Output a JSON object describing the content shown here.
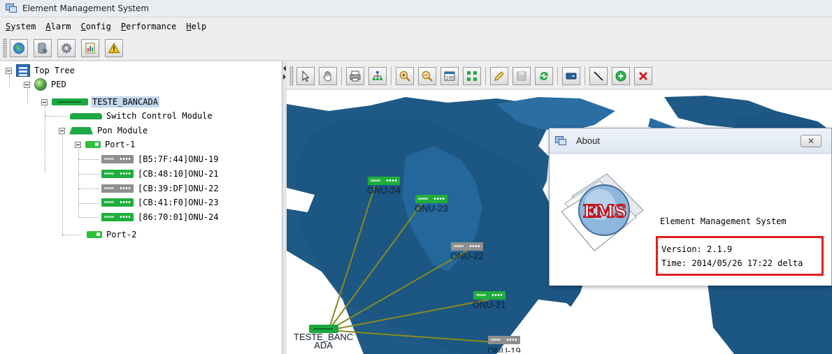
{
  "window": {
    "title": "Element Management System"
  },
  "menu": [
    {
      "label": "System",
      "mnemonic": "S",
      "rest": "ystem"
    },
    {
      "label": "Alarm",
      "mnemonic": "A",
      "rest": "larm"
    },
    {
      "label": "Config",
      "mnemonic": "C",
      "rest": "onfig"
    },
    {
      "label": "Performance",
      "mnemonic": "P",
      "rest": "erformance"
    },
    {
      "label": "Help",
      "mnemonic": "H",
      "rest": "elp"
    }
  ],
  "toolbar_icons": [
    "network-globe-icon",
    "database-icon",
    "settings-gear-icon",
    "report-icon",
    "alarm-warning-icon"
  ],
  "map_toolbar_icons": [
    "select-pointer-icon",
    "pan-hand-icon",
    "print-icon",
    "topology-icon",
    "zoom-in-icon",
    "zoom-out-icon",
    "zoom-100-icon",
    "fit-view-icon",
    "edit-icon",
    "save-icon",
    "refresh-icon",
    "add-device-icon",
    "draw-link-icon",
    "add-icon",
    "delete-icon"
  ],
  "tree": {
    "root": "Top Tree",
    "group": "PED",
    "olt": "TESTE_BANCADA",
    "switch_module": "Switch Control Module",
    "pon_module": "Pon Module",
    "port1": "Port-1",
    "onus": [
      {
        "label": "[B5:7F:44]ONU-19",
        "status": "offline"
      },
      {
        "label": "[CB:48:10]ONU-21",
        "status": "online"
      },
      {
        "label": "[CB:39:DF]ONU-22",
        "status": "offline"
      },
      {
        "label": "[CB:41:F0]ONU-23",
        "status": "online"
      },
      {
        "label": "[86:70:01]ONU-24",
        "status": "online"
      }
    ],
    "port2": "Port-2"
  },
  "map": {
    "olt_label_line1": "TESTE_BANC",
    "olt_label_line2": "ADA",
    "onu24": "ONU-24",
    "onu23": "ONU-23",
    "onu22": "ONU-22",
    "onu21": "ONU-21",
    "onu19": "ONU-19",
    "colors": {
      "ocean": "#ffffff",
      "land": "#1f5a86",
      "link": "#8a8a1e",
      "online": "#1fae3c",
      "offline": "#8f8f8f"
    }
  },
  "about": {
    "title": "About",
    "close_glyph": "✕",
    "logo_text": "EMS",
    "app_name": "Element Management System",
    "version_line": "Version: 2.1.9",
    "time_line": "Time: 2014/05/26 17:22 delta",
    "highlight_color": "#e0201f"
  }
}
